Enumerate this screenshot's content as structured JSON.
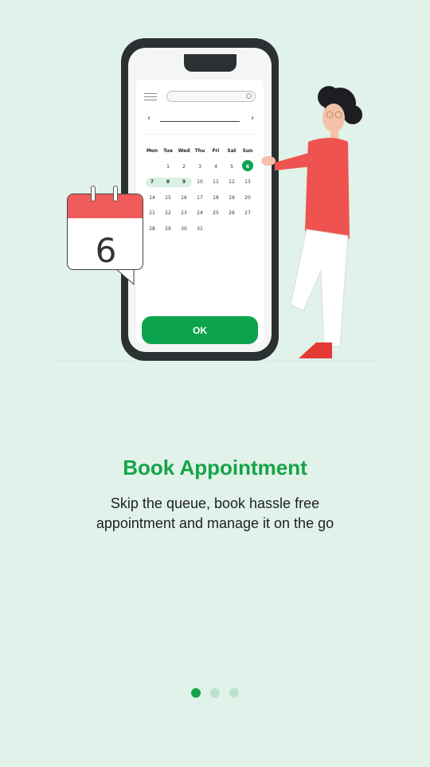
{
  "calendar": {
    "weekdays": [
      "Mon",
      "Tue",
      "Wed",
      "Thu",
      "Fri",
      "Sat",
      "Sun"
    ],
    "weeks": [
      [
        "",
        "1",
        "2",
        "3",
        "4",
        "5",
        "6"
      ],
      [
        "7",
        "8",
        "9",
        "10",
        "11",
        "12",
        "13"
      ],
      [
        "14",
        "15",
        "16",
        "17",
        "18",
        "19",
        "20"
      ],
      [
        "21",
        "22",
        "23",
        "24",
        "25",
        "26",
        "27"
      ],
      [
        "28",
        "29",
        "30",
        "31",
        "",
        "",
        ""
      ]
    ],
    "selected_day": "6",
    "range_days": [
      "7",
      "8",
      "9"
    ]
  },
  "phone": {
    "ok_label": "OK"
  },
  "calendar_badge": {
    "day": "6"
  },
  "onboarding": {
    "title": "Book Appointment",
    "subtitle_line1": "Skip the queue, book hassle free",
    "subtitle_line2": "appointment and manage it on the go"
  },
  "pager": {
    "total": 3,
    "active_index": 0
  },
  "colors": {
    "background": "#e0f2e9",
    "accent": "#16a34a",
    "dot_inactive": "#b9e3cc"
  }
}
